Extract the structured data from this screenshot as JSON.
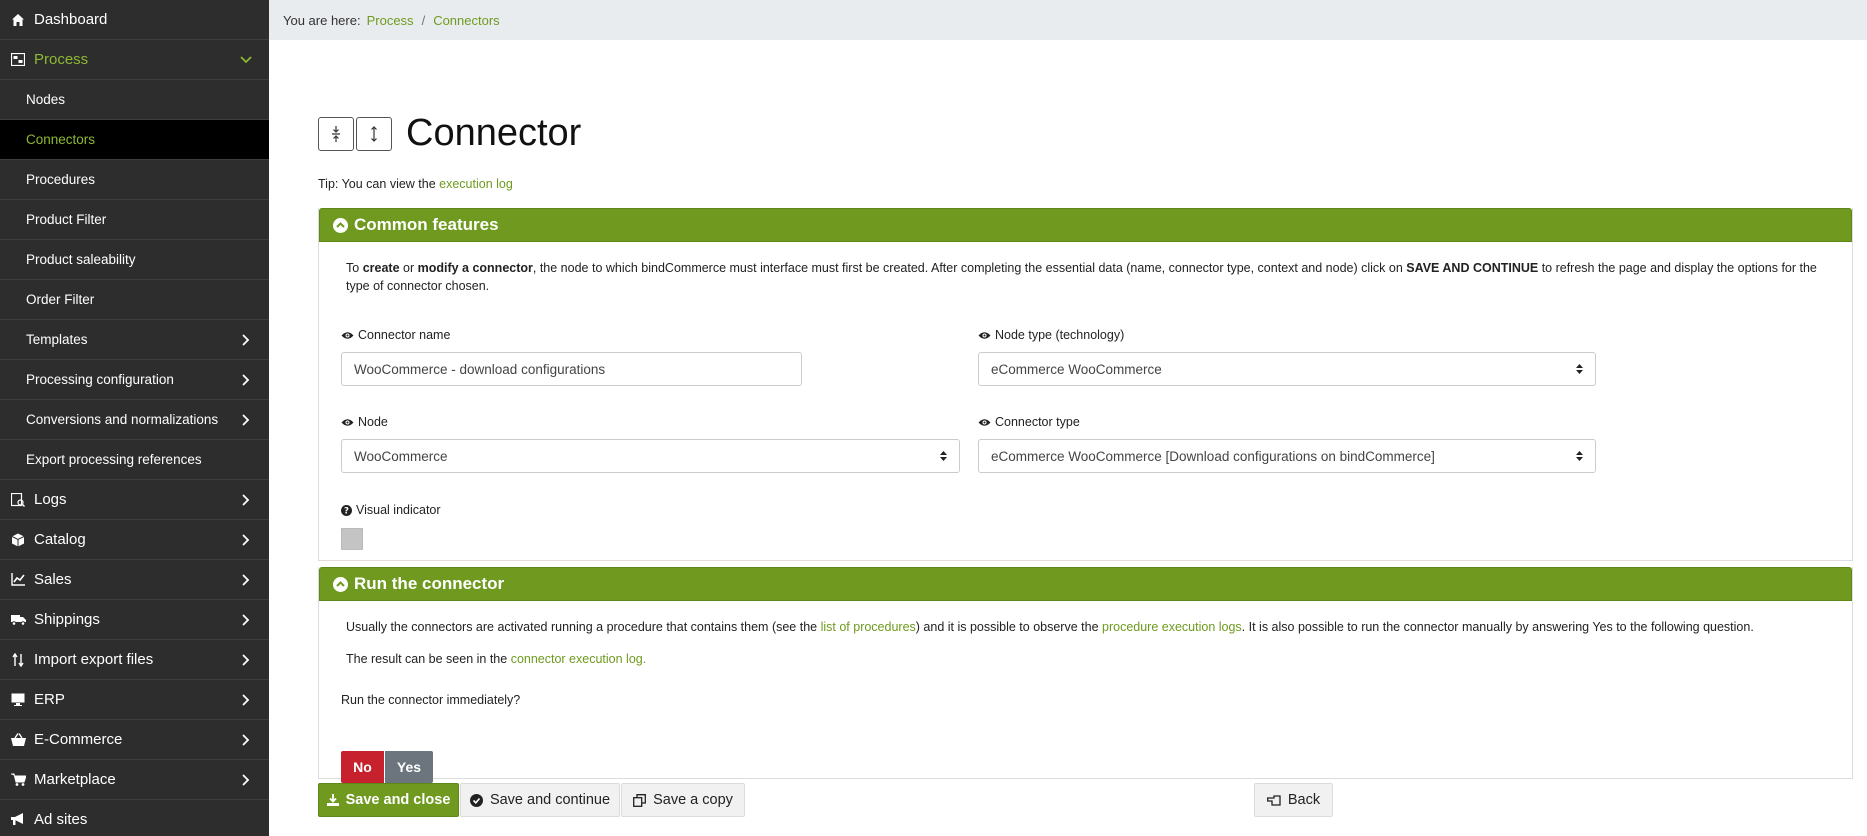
{
  "sidebar": {
    "items": [
      {
        "label": "Dashboard",
        "icon": "home-icon"
      },
      {
        "label": "Process",
        "icon": "process-icon"
      },
      {
        "label": "Nodes"
      },
      {
        "label": "Connectors"
      },
      {
        "label": "Procedures"
      },
      {
        "label": "Product Filter"
      },
      {
        "label": "Product saleability"
      },
      {
        "label": "Order Filter"
      },
      {
        "label": "Templates"
      },
      {
        "label": "Processing configuration"
      },
      {
        "label": "Conversions and normalizations"
      },
      {
        "label": "Export processing references"
      },
      {
        "label": "Logs",
        "icon": "logs-icon"
      },
      {
        "label": "Catalog",
        "icon": "box-icon"
      },
      {
        "label": "Sales",
        "icon": "chart-icon"
      },
      {
        "label": "Shippings",
        "icon": "truck-icon"
      },
      {
        "label": "Import export files",
        "icon": "sort-icon"
      },
      {
        "label": "ERP",
        "icon": "monitor-icon"
      },
      {
        "label": "E-Commerce",
        "icon": "basket-icon"
      },
      {
        "label": "Marketplace",
        "icon": "cart-icon"
      },
      {
        "label": "Ad sites",
        "icon": "megaphone-icon"
      }
    ]
  },
  "breadcrumb": {
    "prefix": "You are here:",
    "items": [
      "Process",
      "Connectors"
    ],
    "separator": "/"
  },
  "page": {
    "title": "Connector",
    "tip_prefix": "Tip: You can view the",
    "tip_link": "execution log"
  },
  "common": {
    "heading": "Common features",
    "intro": {
      "t1": "To ",
      "b1": "create",
      "t2": " or ",
      "b2": "modify a connector",
      "t3": ", the node to which bindCommerce must interface must first be created. After completing the essential data (name, connector type, context and node) click on ",
      "b3": "SAVE AND CONTINUE",
      "t4": " to refresh the page and display the options for the type of connector chosen."
    },
    "connector_name_label": "Connector name",
    "connector_name_value": "WooCommerce - download configurations",
    "node_type_label": "Node type (technology)",
    "node_type_value": "eCommerce WooCommerce",
    "node_label": "Node",
    "node_value": "WooCommerce",
    "connector_type_label": "Connector type",
    "connector_type_value": "eCommerce WooCommerce [Download configurations on bindCommerce]",
    "visual_indicator_label": "Visual indicator",
    "visual_indicator_color": "#c4c4c4"
  },
  "run": {
    "heading": "Run the connector",
    "line1": {
      "t1": "Usually the connectors are activated running a procedure that contains them (see the ",
      "l1": "list of procedures",
      "t2": ") and it is possible to observe the ",
      "l2": "procedure execution logs",
      "t3": ". It is also possible to run the connector manually by answering Yes to the following question."
    },
    "line2": {
      "t1": "The result can be seen in the ",
      "l1": "connector execution log."
    },
    "question": "Run the connector immediately?",
    "no_label": "No",
    "yes_label": "Yes"
  },
  "footer": {
    "save_close": "Save and close",
    "save_continue": "Save and continue",
    "save_copy": "Save a copy",
    "back": "Back"
  },
  "colors": {
    "accent": "#6f9a1f",
    "sidebar_bg": "#2d2d2d",
    "active_text": "#8db832",
    "no_button": "#c8212e",
    "yes_button": "#6c757d"
  }
}
